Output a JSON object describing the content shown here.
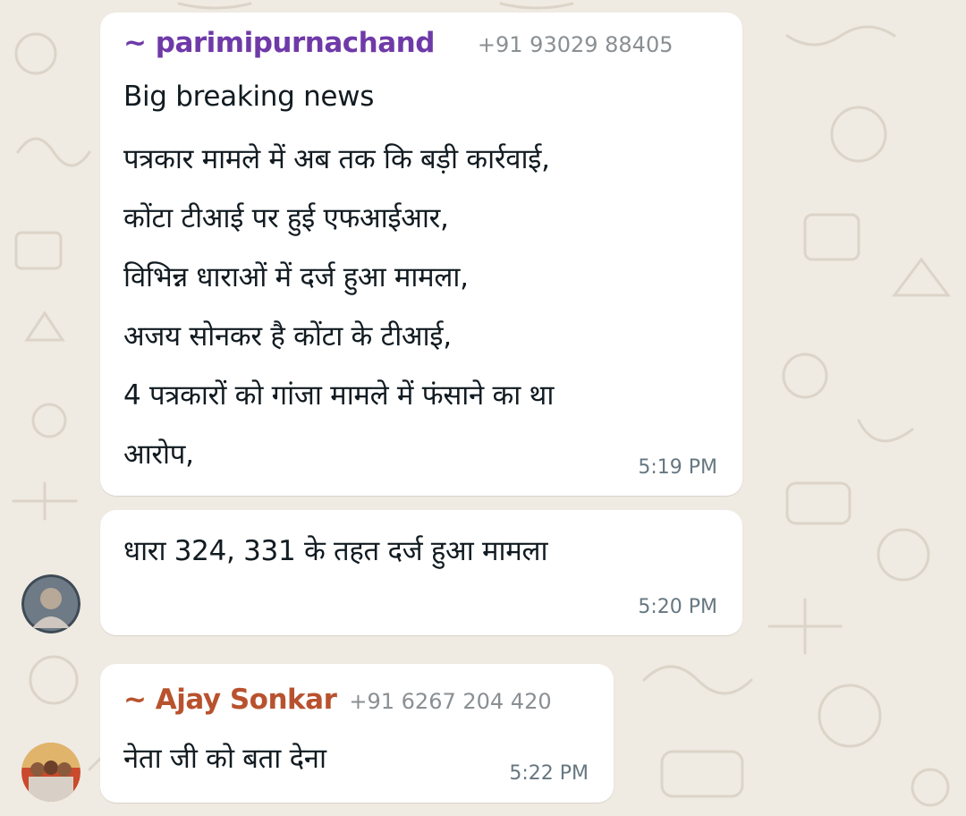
{
  "colors": {
    "wallpaper": "#efeae2",
    "bubble": "#ffffff",
    "sender1_name": "#6f3aa8",
    "sender2_name": "#b8522e",
    "phone": "#8a8f93",
    "timestamp": "#667781"
  },
  "messages": [
    {
      "sender_name": "~ parimipurnachand",
      "sender_phone": "+91 93029 88405",
      "lines": [
        "Big breaking news",
        "पत्रकार मामले में अब तक कि बड़ी कार्रवाई,",
        "कोंटा टीआई पर हुई एफआईआर,",
        "विभिन्न धाराओं में दर्ज हुआ मामला,",
        "अजय सोनकर है कोंटा के टीआई,",
        "4 पत्रकारों को गांजा मामले में फंसाने का था",
        "आरोप,"
      ],
      "time": "5:19 PM"
    },
    {
      "lines": [
        "धारा 324, 331 के तहत दर्ज हुआ मामला"
      ],
      "time": "5:20 PM",
      "avatar_icon": "person-avatar-icon"
    },
    {
      "sender_name": "~ Ajay Sonkar",
      "sender_phone": "+91 6267 204 420",
      "lines": [
        "नेता जी को बता देना"
      ],
      "time": "5:22 PM",
      "avatar_icon": "group-photo-avatar-icon"
    }
  ]
}
